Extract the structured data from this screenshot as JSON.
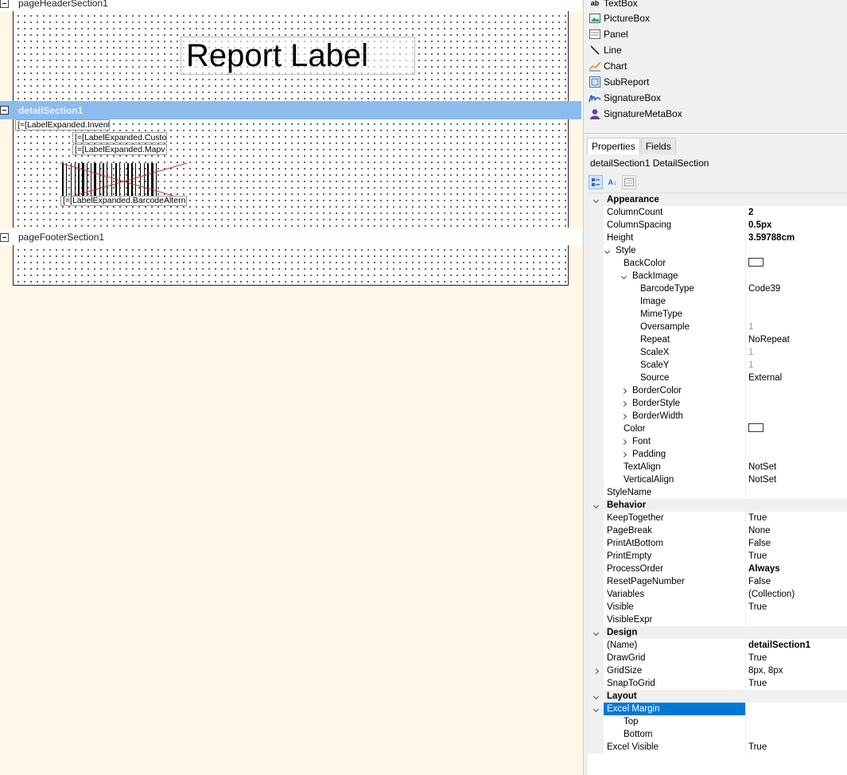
{
  "designer": {
    "page_header": {
      "label": "pageHeaderSection1",
      "report_label": "Report Label"
    },
    "detail": {
      "label": "detailSection1",
      "fields": [
        "[=[LabelExpanded.Invent",
        "[=[LabelExpanded.Custo",
        "[=[LabelExpanded.Mapv"
      ],
      "barcode_caption": "[=[LabelExpanded.BarcodeAltern"
    },
    "page_footer": {
      "label": "pageFooterSection1"
    }
  },
  "toolbox": {
    "items": [
      {
        "label": "TextBox",
        "icon": "textbox-icon"
      },
      {
        "label": "PictureBox",
        "icon": "picturebox-icon"
      },
      {
        "label": "Panel",
        "icon": "panel-icon"
      },
      {
        "label": "Line",
        "icon": "line-icon"
      },
      {
        "label": "Chart",
        "icon": "chart-icon"
      },
      {
        "label": "SubReport",
        "icon": "subreport-icon"
      },
      {
        "label": "SignatureBox",
        "icon": "signature-icon"
      },
      {
        "label": "SignatureMetaBox",
        "icon": "user-icon"
      }
    ]
  },
  "properties": {
    "tabs": [
      "Properties",
      "Fields"
    ],
    "object": "detailSection1 DetailSection",
    "rows": [
      {
        "kind": "cat",
        "name": "Appearance"
      },
      {
        "name": "ColumnCount",
        "value": "2",
        "bold": true
      },
      {
        "name": "ColumnSpacing",
        "value": "0.5px",
        "bold": true
      },
      {
        "name": "Height",
        "value": "3.59788cm",
        "bold": true
      },
      {
        "name": "Style",
        "value": "",
        "exp": "down"
      },
      {
        "name": "BackColor",
        "value": "",
        "indent": 1,
        "swatch": true
      },
      {
        "name": "BackImage",
        "value": "",
        "indent": 1,
        "exp": "down"
      },
      {
        "name": "BarcodeType",
        "value": "Code39",
        "indent": 2
      },
      {
        "name": "Image",
        "value": "",
        "indent": 2
      },
      {
        "name": "MimeType",
        "value": "",
        "indent": 2
      },
      {
        "name": "Oversample",
        "value": "1",
        "indent": 2,
        "dim": true
      },
      {
        "name": "Repeat",
        "value": "NoRepeat",
        "indent": 2
      },
      {
        "name": "ScaleX",
        "value": "1",
        "indent": 2,
        "dim": true
      },
      {
        "name": "ScaleY",
        "value": "1",
        "indent": 2,
        "dim": true
      },
      {
        "name": "Source",
        "value": "External",
        "indent": 2
      },
      {
        "name": "BorderColor",
        "value": "",
        "indent": 1,
        "exp": "right"
      },
      {
        "name": "BorderStyle",
        "value": "",
        "indent": 1,
        "exp": "right"
      },
      {
        "name": "BorderWidth",
        "value": "",
        "indent": 1,
        "exp": "right"
      },
      {
        "name": "Color",
        "value": "",
        "indent": 1,
        "swatch": true
      },
      {
        "name": "Font",
        "value": "",
        "indent": 1,
        "exp": "right"
      },
      {
        "name": "Padding",
        "value": "",
        "indent": 1,
        "exp": "right"
      },
      {
        "name": "TextAlign",
        "value": "NotSet",
        "indent": 1
      },
      {
        "name": "VerticalAlign",
        "value": "NotSet",
        "indent": 1
      },
      {
        "name": "StyleName",
        "value": ""
      },
      {
        "kind": "cat",
        "name": "Behavior"
      },
      {
        "name": "KeepTogether",
        "value": "True"
      },
      {
        "name": "PageBreak",
        "value": "None"
      },
      {
        "name": "PrintAtBottom",
        "value": "False"
      },
      {
        "name": "PrintEmpty",
        "value": "True"
      },
      {
        "name": "ProcessOrder",
        "value": "Always",
        "bold": true
      },
      {
        "name": "ResetPageNumber",
        "value": "False"
      },
      {
        "name": "Variables",
        "value": "(Collection)"
      },
      {
        "name": "Visible",
        "value": "True"
      },
      {
        "name": "VisibleExpr",
        "value": ""
      },
      {
        "kind": "cat",
        "name": "Design"
      },
      {
        "name": "(Name)",
        "value": "detailSection1",
        "bold": true
      },
      {
        "name": "DrawGrid",
        "value": "True"
      },
      {
        "name": "GridSize",
        "value": "8px, 8px",
        "gutter": "right"
      },
      {
        "name": "SnapToGrid",
        "value": "True"
      },
      {
        "kind": "cat",
        "name": "Layout"
      },
      {
        "name": "Excel Margin",
        "value": "",
        "gutter": "down",
        "selected": true
      },
      {
        "name": "Top",
        "value": "",
        "indent": 1
      },
      {
        "name": "Bottom",
        "value": "",
        "indent": 1
      },
      {
        "name": "Excel Visible",
        "value": "True"
      }
    ]
  }
}
